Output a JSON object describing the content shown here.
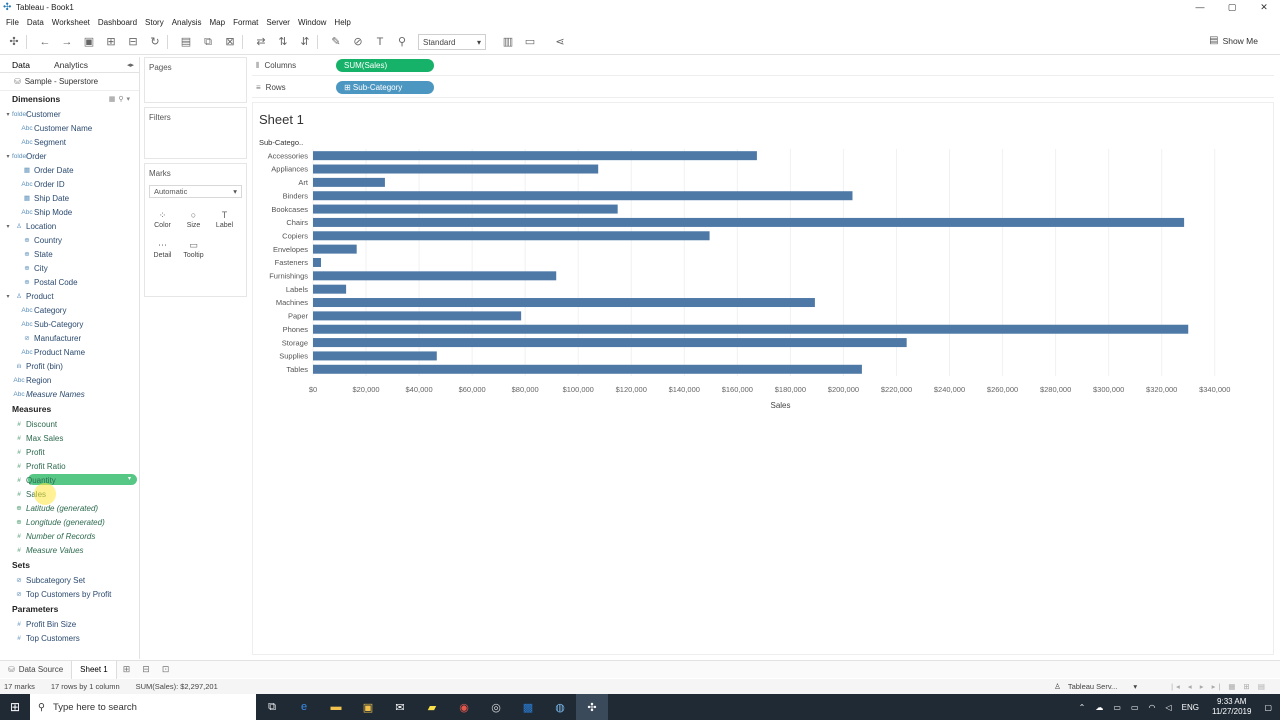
{
  "window": {
    "title": "Tableau - Book1",
    "controls": [
      "—",
      "▢",
      "✕"
    ]
  },
  "menu": [
    "File",
    "Data",
    "Worksheet",
    "Dashboard",
    "Story",
    "Analysis",
    "Map",
    "Format",
    "Server",
    "Window",
    "Help"
  ],
  "toolbar": {
    "fit": "Standard",
    "show_me": "Show Me"
  },
  "data_pane": {
    "tabs": [
      "Data",
      "Analytics"
    ],
    "datasource": "Sample - Superstore",
    "dimensions_label": "Dimensions",
    "dimensions": [
      {
        "name": "Customer",
        "level": 0,
        "icon": "folder",
        "caret": "▾"
      },
      {
        "name": "Customer Name",
        "level": 1,
        "icon": "Abc"
      },
      {
        "name": "Segment",
        "level": 1,
        "icon": "Abc"
      },
      {
        "name": "Order",
        "level": 0,
        "icon": "folder",
        "caret": "▾"
      },
      {
        "name": "Order Date",
        "level": 1,
        "icon": "▦"
      },
      {
        "name": "Order ID",
        "level": 1,
        "icon": "Abc"
      },
      {
        "name": "Ship Date",
        "level": 1,
        "icon": "▦"
      },
      {
        "name": "Ship Mode",
        "level": 1,
        "icon": "Abc"
      },
      {
        "name": "Location",
        "level": 0,
        "icon": "♙",
        "caret": "▾"
      },
      {
        "name": "Country",
        "level": 1,
        "icon": "⊕"
      },
      {
        "name": "State",
        "level": 1,
        "icon": "⊕"
      },
      {
        "name": "City",
        "level": 1,
        "icon": "⊕"
      },
      {
        "name": "Postal Code",
        "level": 1,
        "icon": "⊕"
      },
      {
        "name": "Product",
        "level": 0,
        "icon": "♙",
        "caret": "▾"
      },
      {
        "name": "Category",
        "level": 1,
        "icon": "Abc"
      },
      {
        "name": "Sub-Category",
        "level": 1,
        "icon": "Abc"
      },
      {
        "name": "Manufacturer",
        "level": 1,
        "icon": "⊘"
      },
      {
        "name": "Product Name",
        "level": 1,
        "icon": "Abc"
      },
      {
        "name": "Profit (bin)",
        "level": 0,
        "icon": "ılı"
      },
      {
        "name": "Region",
        "level": 0,
        "icon": "Abc"
      },
      {
        "name": "Measure Names",
        "level": 0,
        "icon": "Abc",
        "italic": true
      }
    ],
    "measures_label": "Measures",
    "measures": [
      {
        "name": "Discount",
        "icon": "#"
      },
      {
        "name": "Max Sales",
        "icon": "#"
      },
      {
        "name": "Profit",
        "icon": "#"
      },
      {
        "name": "Profit Ratio",
        "icon": "#"
      },
      {
        "name": "Quantity",
        "icon": "#",
        "selected": true
      },
      {
        "name": "Sales",
        "icon": "#"
      },
      {
        "name": "Latitude (generated)",
        "icon": "⊕",
        "italic": true
      },
      {
        "name": "Longitude (generated)",
        "icon": "⊕",
        "italic": true
      },
      {
        "name": "Number of Records",
        "icon": "#",
        "italic": true
      },
      {
        "name": "Measure Values",
        "icon": "#",
        "italic": true
      }
    ],
    "sets_label": "Sets",
    "sets": [
      {
        "name": "Subcategory Set",
        "icon": "⊘"
      },
      {
        "name": "Top Customers by Profit",
        "icon": "⊘"
      }
    ],
    "parameters_label": "Parameters",
    "parameters": [
      {
        "name": "Profit Bin Size",
        "icon": "#"
      },
      {
        "name": "Top Customers",
        "icon": "#"
      }
    ]
  },
  "cards": {
    "pages": "Pages",
    "filters": "Filters",
    "marks": "Marks",
    "mark_type": "Automatic",
    "mark_buttons": [
      {
        "label": "Color",
        "icon": "⁘"
      },
      {
        "label": "Size",
        "icon": "○"
      },
      {
        "label": "Label",
        "icon": "T"
      },
      {
        "label": "Detail",
        "icon": "⋯"
      },
      {
        "label": "Tooltip",
        "icon": "▭"
      }
    ]
  },
  "shelves": {
    "columns_label": "Columns",
    "columns_pill": "SUM(Sales)",
    "rows_label": "Rows",
    "rows_pill": "⊞ Sub-Category"
  },
  "sheet": {
    "title": "Sheet 1"
  },
  "chart_data": {
    "type": "bar",
    "orientation": "horizontal",
    "row_header": "Sub-Catego..",
    "categories": [
      "Accessories",
      "Appliances",
      "Art",
      "Binders",
      "Bookcases",
      "Chairs",
      "Copiers",
      "Envelopes",
      "Fasteners",
      "Furnishings",
      "Labels",
      "Machines",
      "Paper",
      "Phones",
      "Storage",
      "Supplies",
      "Tables"
    ],
    "values": [
      167380,
      107532,
      27119,
      203413,
      114880,
      328449,
      149528,
      16476,
      3024,
      91705,
      12486,
      189239,
      78479,
      330007,
      223844,
      46674,
      206966
    ],
    "xlabel": "Sales",
    "xlim": [
      0,
      345000
    ],
    "ticks": [
      0,
      20000,
      40000,
      60000,
      80000,
      100000,
      120000,
      140000,
      160000,
      180000,
      200000,
      220000,
      240000,
      260000,
      280000,
      300000,
      320000,
      340000
    ],
    "tick_labels": [
      "$0",
      "$20,000",
      "$40,000",
      "$60,000",
      "$80,000",
      "$100,000",
      "$120,000",
      "$140,000",
      "$160,000",
      "$180,000",
      "$200,000",
      "$220,000",
      "$240,000",
      "$260,000",
      "$280,000",
      "$300,000",
      "$320,000",
      "$340,000"
    ],
    "bar_color": "#4e79a7",
    "grid": true
  },
  "tabs": {
    "data_source": "Data Source",
    "sheet": "Sheet 1"
  },
  "status": {
    "marks": "17 marks",
    "rows": "17 rows by 1 column",
    "sum": "SUM(Sales): $2,297,201",
    "server": "Tableau Serv..."
  },
  "taskbar": {
    "search_placeholder": "Type here to search",
    "time": "9:33 AM",
    "date": "11/27/2019",
    "lang": "ENG"
  }
}
